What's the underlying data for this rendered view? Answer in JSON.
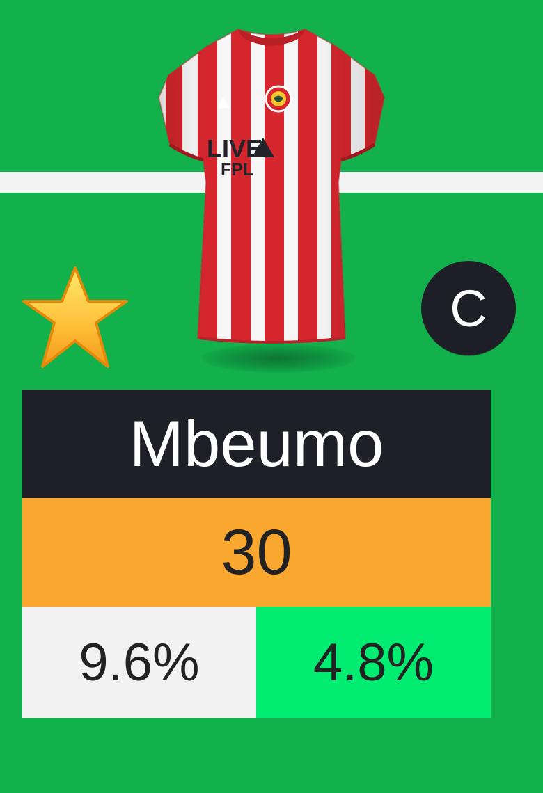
{
  "player": {
    "name": "Mbeumo",
    "points": "30",
    "captain_label": "C",
    "stat_left": "9.6%",
    "stat_right": "4.8%",
    "star_icon": "star-icon"
  },
  "shirt": {
    "sponsor_line1": "LIVE",
    "sponsor_line2": "FPL",
    "icon": "football-shirt-icon"
  },
  "colors": {
    "background": "#12b14c",
    "name_bg": "#1f2027",
    "points_bg": "#f9a72e",
    "left_stat_bg": "#f2f2f2",
    "right_stat_bg": "#00ed72",
    "captain_bg": "#1e1f26",
    "shirt_red": "#d9272f",
    "shirt_white": "#fbfbfb"
  }
}
